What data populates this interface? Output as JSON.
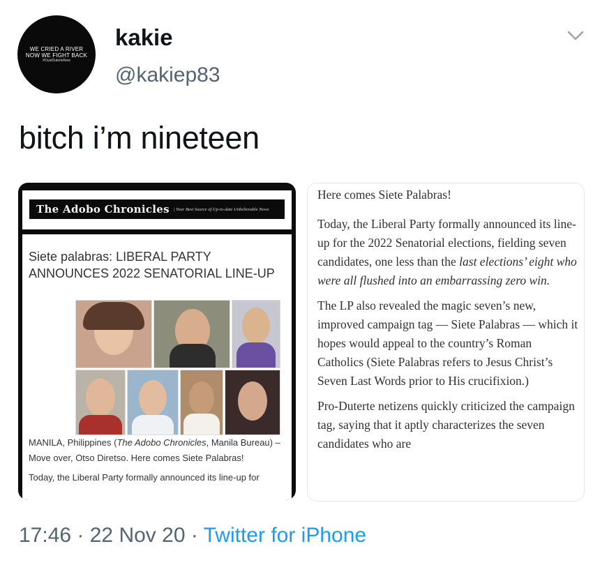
{
  "user": {
    "display_name": "kakie",
    "handle": "@kakiep83",
    "avatar_lines": [
      "WE CRIED A RIVER",
      "NOW WE FIGHT BACK",
      "#OustDuterteNow"
    ]
  },
  "tweet": {
    "text": "bitch i’m nineteen"
  },
  "left_image": {
    "masthead_title": "The Adobo Chronicles",
    "masthead_tagline": "| Your Best Source of Up-to-date Unbelievable News",
    "headline": "Siete palabras: LIBERAL PARTY ANNOUNCES 2022 SENATORIAL LINE-UP",
    "lede_pre": "MANILA, Philippines (",
    "lede_source": "The Adobo Chronicles",
    "lede_post": ", Manila Bureau) – Move over, Otso Diretso. Here comes Siete Palabras!",
    "para": "Today, the Liberal Party formally announced its line-up for"
  },
  "right_image": {
    "p1": "Here comes Siete Palabras!",
    "p2_plain": "Today, the Liberal Party formally announced its line-up for the 2022 Senatorial elections, fielding seven candidates, one less than the",
    "p2_italic": "last elections’ eight who were all flushed into an embarrassing zero win.",
    "p3": "The LP also revealed the magic seven’s new, improved campaign tag — Siete Palabras — which it hopes would appeal to the country’s Roman Catholics (Siete Palabras refers to Jesus Christ’s Seven Last Words prior to His crucifixion.)",
    "p4": "Pro-Duterte netizens quickly criticized the campaign tag, saying that it aptly characterizes the seven candidates who are"
  },
  "meta": {
    "time": "17:46",
    "sep1": " · ",
    "date": "22 Nov 20",
    "sep2": " · ",
    "source": "Twitter for iPhone"
  },
  "icons": {
    "caret": "chevron-down-icon"
  },
  "colors": {
    "text": "#0f1419",
    "secondary": "#536471",
    "link": "#1d9bf0"
  }
}
